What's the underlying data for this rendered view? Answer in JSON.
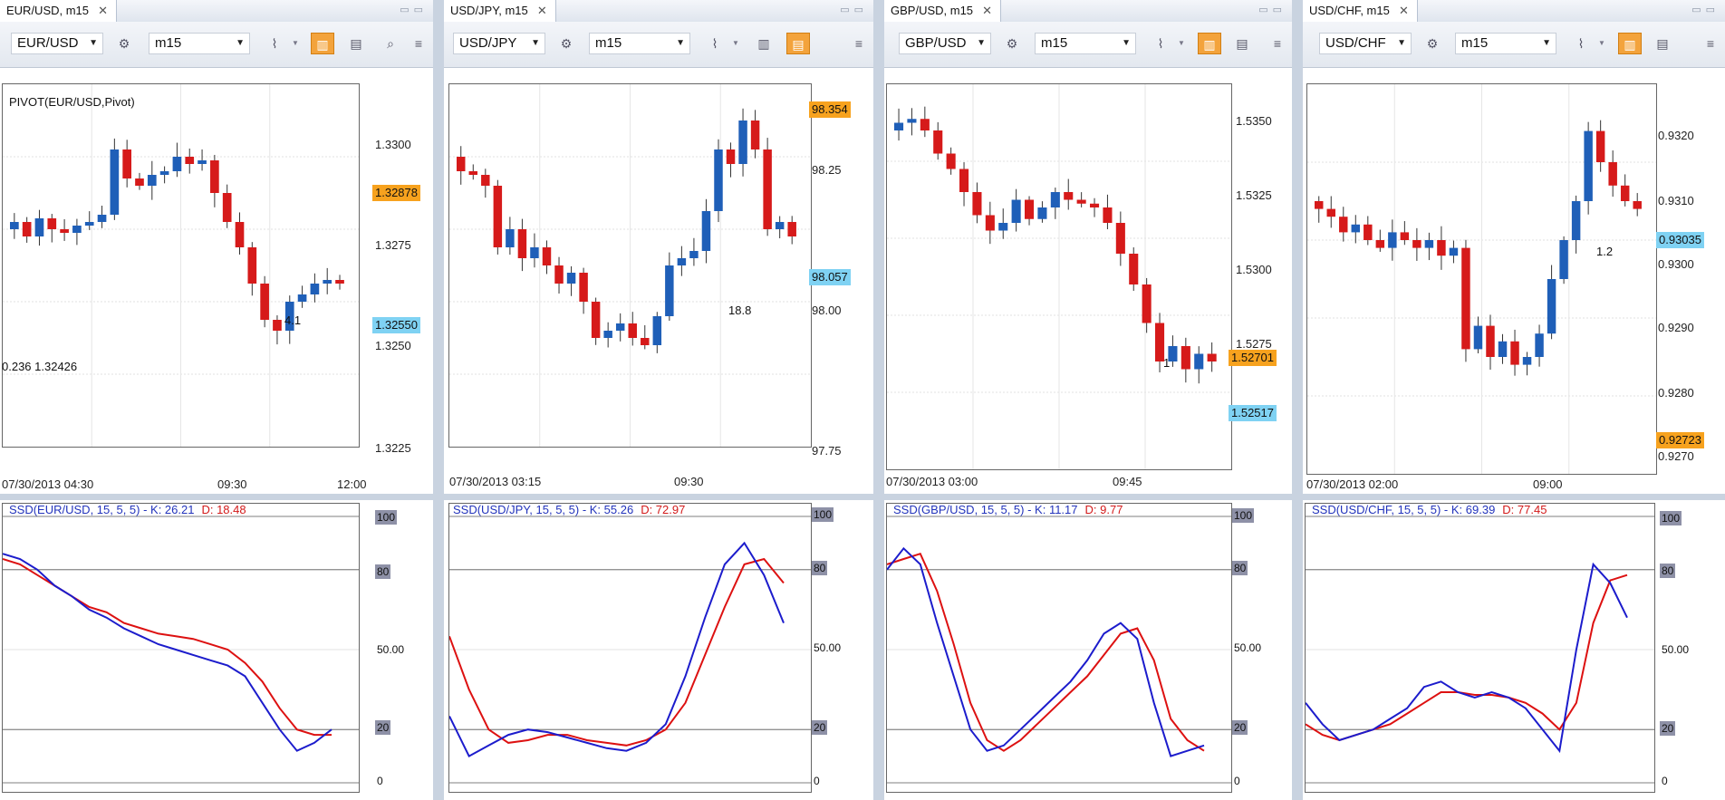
{
  "panels": [
    {
      "tab_title": "EUR/USD, m15",
      "symbol": "EUR/USD",
      "timeframe": "m15",
      "indicator_label": "PIVOT(EUR/USD,Pivot)",
      "fib_label": "0.236 1.32426",
      "price_ticks": [
        "1.3300",
        "1.3275",
        "1.3250",
        "1.3225"
      ],
      "ask_tag": "1.32878",
      "bid_tag": "1.32550",
      "time_labels": [
        "07/30/2013 04:30",
        "09:30",
        "12:00"
      ],
      "annotation": "4.1",
      "osc_title": "SSD(EUR/USD, 15, 5, 5) -  K: 26.21",
      "osc_d": "D: 18.48",
      "osc_levels": [
        "100",
        "80",
        "50.00",
        "20",
        "0"
      ]
    },
    {
      "tab_title": "USD/JPY, m15",
      "symbol": "USD/JPY",
      "timeframe": "m15",
      "price_ticks": [
        "98.25",
        "98.00",
        "97.75"
      ],
      "ask_tag": "98.354",
      "bid_tag": "98.057",
      "time_labels": [
        "07/30/2013 03:15",
        "09:30"
      ],
      "annotation": "18.8",
      "osc_title": "SSD(USD/JPY, 15, 5, 5) -  K: 55.26",
      "osc_d": "D: 72.97",
      "osc_levels": [
        "100",
        "80",
        "50.00",
        "20",
        "0"
      ]
    },
    {
      "tab_title": "GBP/USD, m15",
      "symbol": "GBP/USD",
      "timeframe": "m15",
      "price_ticks": [
        "1.5350",
        "1.5325",
        "1.5300",
        "1.5275"
      ],
      "ask_tag": "1.52701",
      "bid_tag": "1.52517",
      "time_labels": [
        "07/30/2013 03:00",
        "09:45"
      ],
      "annotation": "1",
      "osc_title": "SSD(GBP/USD, 15, 5, 5) -  K: 11.17",
      "osc_d": "D: 9.77",
      "osc_levels": [
        "100",
        "80",
        "50.00",
        "20",
        "0"
      ]
    },
    {
      "tab_title": "USD/CHF, m15",
      "symbol": "USD/CHF",
      "timeframe": "m15",
      "price_ticks": [
        "0.9320",
        "0.9310",
        "0.9300",
        "0.9290",
        "0.9280",
        "0.9270"
      ],
      "ask_tag": "0.92723",
      "bid_tag": "0.93035",
      "time_labels": [
        "07/30/2013 02:00",
        "09:00"
      ],
      "annotation": "1.2",
      "osc_title": "SSD(USD/CHF, 15, 5, 5) -  K: 69.39",
      "osc_d": "D: 77.45",
      "osc_levels": [
        "100",
        "80",
        "50.00",
        "20",
        "0"
      ]
    }
  ],
  "colors": {
    "bull": "#1f5fb8",
    "bear": "#d61a1a",
    "k_line": "#1c1ccc",
    "d_line": "#dd1111",
    "ask_tag": "#f7a21e",
    "bid_tag": "#7fd2f3"
  },
  "icons": [
    "close-icon",
    "window-restore-icon",
    "chart-type-icon",
    "candles-icon",
    "bars-icon",
    "crosshair-icon",
    "menu-icon"
  ]
}
